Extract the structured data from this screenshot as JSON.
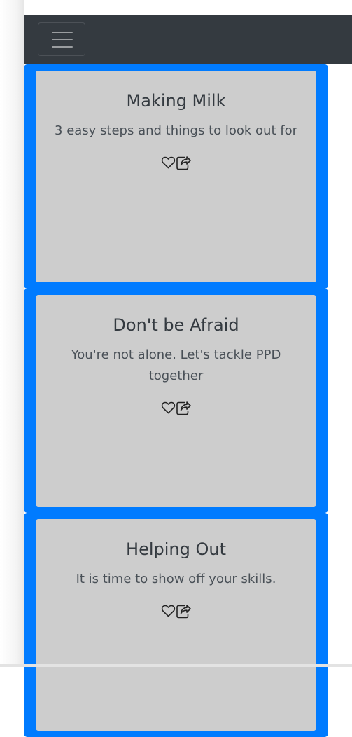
{
  "navbar": {
    "toggler_icon": "hamburger-menu-icon"
  },
  "cards": [
    {
      "title": "Making Milk",
      "text": "3 easy steps and things to look out for",
      "like_icon": "heart-icon",
      "share_icon": "share-icon"
    },
    {
      "title": "Don't be Afraid",
      "text": "You're not alone. Let's tackle PPD together",
      "like_icon": "heart-icon",
      "share_icon": "share-icon"
    },
    {
      "title": "Helping Out",
      "text": "It is time to show off your skills.",
      "like_icon": "heart-icon",
      "share_icon": "share-icon"
    }
  ],
  "colors": {
    "navbar_bg": "#343a40",
    "card_border": "#007bff",
    "card_bg": "#cdcdcd",
    "text": "#343a40"
  }
}
